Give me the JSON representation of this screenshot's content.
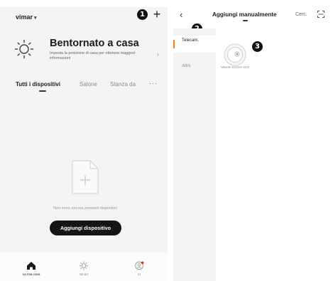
{
  "left": {
    "home_selector": "vimar",
    "welcome_title": "Bentornato a casa",
    "welcome_subtitle": "Imposta la posizione di casa per ottenere maggiori informazioni",
    "tabs": [
      "Tutti i dispositivi",
      "Salone",
      "Stanza da"
    ],
    "more_label": "···",
    "empty_text": "Non sono ancora presenti dispositivi",
    "add_device_button": "Aggiungi dispositivo",
    "nav": [
      {
        "label": "La mia casa",
        "icon": "home-icon"
      },
      {
        "label": "Smart",
        "icon": "sun-icon"
      },
      {
        "label": "Io",
        "icon": "profile-icon"
      }
    ]
  },
  "right": {
    "title": "Aggiungi manualmente",
    "search_link": "Cerc.",
    "categories": [
      {
        "label": "Telecam.",
        "active": true
      },
      {
        "label": "Altro",
        "active": false
      }
    ],
    "device_name": "VIMAR XXXXX-XXX"
  },
  "callouts": [
    "1",
    "2",
    "3"
  ],
  "colors": {
    "accent_orange": "#ff7a1a",
    "button_dark": "#141414",
    "panel_gray": "#f4f4f5"
  }
}
